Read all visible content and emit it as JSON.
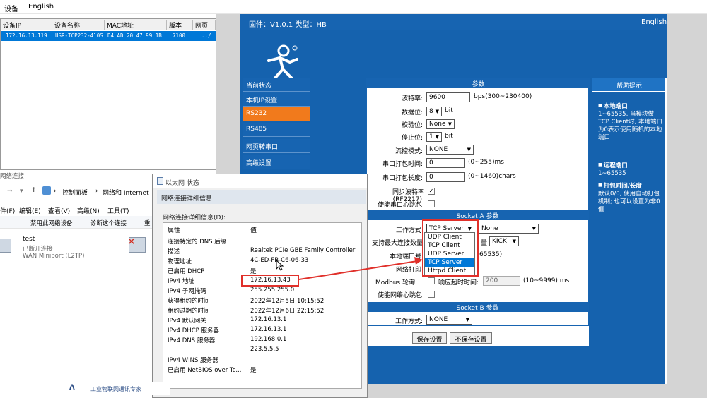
{
  "tool": {
    "menu": [
      "设备",
      "English"
    ],
    "columns": [
      "设备IP",
      "设备名称",
      "MAC地址",
      "版本",
      "网页"
    ],
    "rows": [
      {
        "ip": "172.16.13.119",
        "name": "USR-TCP232-410S",
        "mac": "D4 AD 20 47 99 1B",
        "version": "7100",
        "web": "../"
      }
    ]
  },
  "web": {
    "firmware": "固件：V1.0.1 类型：HB",
    "lang_link": "English",
    "sidebar": [
      {
        "label": "当前状态",
        "active": false
      },
      {
        "label": "本机IP设置",
        "active": false
      },
      {
        "label": "RS232",
        "active": true
      },
      {
        "label": "RS485",
        "active": false
      },
      {
        "label": "网页转串口",
        "active": false
      },
      {
        "label": "高级设置",
        "active": false
      }
    ],
    "params_title": "参数",
    "form": {
      "baud_label": "波特率:",
      "baud_value": "9600",
      "baud_unit": "bps(300~230400)",
      "databits_label": "数据位:",
      "databits_value": "8",
      "databits_unit": "bit",
      "parity_label": "校验位:",
      "parity_value": "None",
      "stopbits_label": "停止位:",
      "stopbits_value": "1",
      "stopbits_unit": "bit",
      "flow_label": "流控模式:",
      "flow_value": "NONE",
      "packtime_label": "串口打包时间:",
      "packtime_value": "0",
      "packtime_unit": "(0~255)ms",
      "packlen_label": "串口打包长度:",
      "packlen_value": "0",
      "packlen_unit": "(0~1460)chars",
      "rfc_label": "同步波特率(RF2217):",
      "heartbeat_label": "使能串口心跳包:"
    },
    "socket_a": {
      "title": "Socket A 参数",
      "mode_label": "工作方式",
      "mode_value": "TCP Server",
      "mode2_value": "None",
      "maxconn_label": "支持最大连接数量",
      "maxconn_suffix": "量",
      "maxconn_value": "KICK",
      "localport_label": "本地端口号",
      "localport_range": "65535)",
      "netprint_label": "网络打印",
      "modbus_label": "Modbus 轮询:",
      "modbus_timeout_label": "响应超时时间:",
      "modbus_timeout_value": "200",
      "modbus_unit": "(10~9999) ms",
      "netheart_label": "使能网络心跳包:"
    },
    "socket_b": {
      "title": "Socket B 参数",
      "mode_label": "工作方式:",
      "mode_value": "NONE"
    },
    "buttons": {
      "save": "保存设置",
      "nosave": "不保存设置"
    },
    "dropdown": [
      "UDP Client",
      "TCP Client",
      "UDP Server",
      "TCP Server",
      "Httpd Client"
    ],
    "dropdown_selected": 3,
    "help": {
      "title": "帮助提示",
      "blocks": [
        {
          "title": "本地端口",
          "text": "1~65535, 当模块做TCP Client时, 本地端口为0表示使用随机的本地端口"
        },
        {
          "title": "远程端口",
          "text": "1~65535"
        },
        {
          "title": "打包时间/长度",
          "text": "默认0/0, 使用自动打包机制; 也可以设置为非0值"
        }
      ]
    }
  },
  "network": {
    "title": "网络连接",
    "address": [
      "控制面板",
      "网络和 Internet"
    ],
    "menu": [
      "件(F)",
      "编辑(E)",
      "查看(V)",
      "高级(N)",
      "工具(T)"
    ],
    "toolbar": [
      "禁用此网络设备",
      "诊断这个连接",
      "重"
    ],
    "connection": {
      "name": "test",
      "status": "已断开连接",
      "device": "WAN Miniport (L2TP)"
    }
  },
  "status": {
    "title": "以太网 状态",
    "details_title": "网络连接详细信息",
    "details_sub": "网络连接详细信息(D):",
    "col_prop": "属性",
    "col_val": "值",
    "rows": [
      {
        "p": "连接特定的 DNS 后缀",
        "v": ""
      },
      {
        "p": "描述",
        "v": "Realtek PCIe GBE Family Controller"
      },
      {
        "p": "物理地址",
        "v": "4C-ED-FB-C6-06-33"
      },
      {
        "p": "已启用 DHCP",
        "v": "是"
      },
      {
        "p": "IPv4 地址",
        "v": "172.16.13.43"
      },
      {
        "p": "IPv4 子网掩码",
        "v": "255.255.255.0"
      },
      {
        "p": "获得租约的时间",
        "v": "2022年12月5日 10:15:52"
      },
      {
        "p": "租约过期的时间",
        "v": "2022年12月6日 22:15:52"
      },
      {
        "p": "IPv4 默认网关",
        "v": "172.16.13.1"
      },
      {
        "p": "IPv4 DHCP 服务器",
        "v": "172.16.13.1"
      },
      {
        "p": "IPv4 DNS 服务器",
        "v": "192.168.0.1"
      },
      {
        "p": "",
        "v": "223.5.5.5"
      },
      {
        "p": "IPv4 WINS 服务器",
        "v": ""
      },
      {
        "p": "已启用 NetBIOS over Tc...",
        "v": "是"
      }
    ]
  },
  "brand": "工业物联网通讯专家",
  "colors": {
    "accent_blue": "#1764b1",
    "active_orange": "#f17a1c",
    "highlight_red": "#e0302a",
    "selection_blue": "#0078d7"
  }
}
